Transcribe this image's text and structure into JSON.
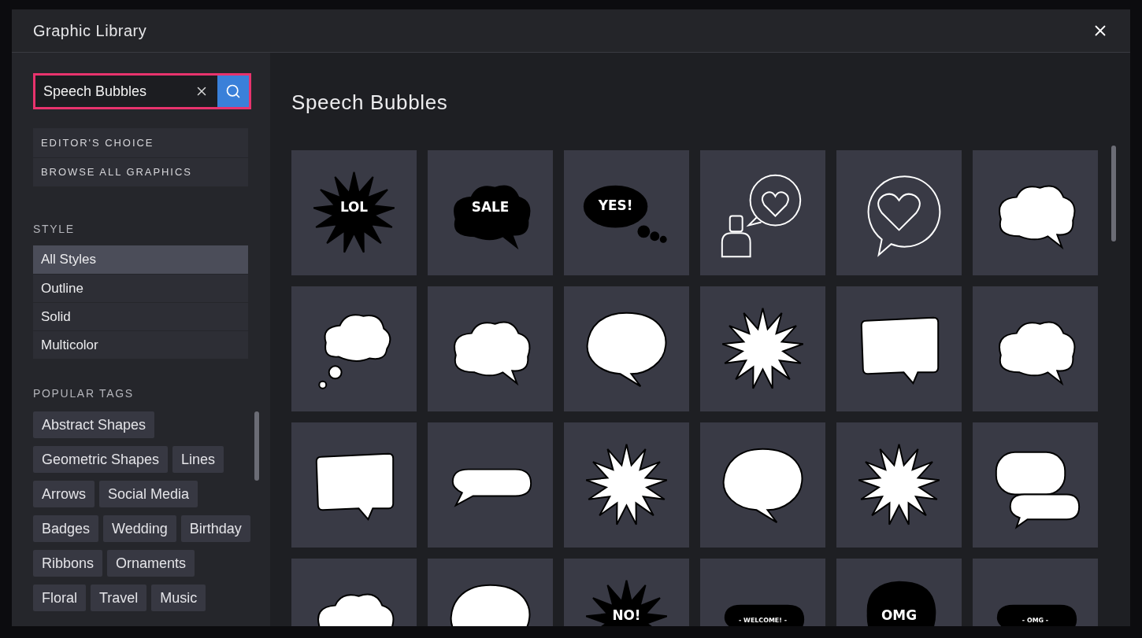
{
  "window": {
    "title": "Graphic Library"
  },
  "search": {
    "value": "Speech Bubbles"
  },
  "quick_links": [
    {
      "label": "EDITOR'S CHOICE"
    },
    {
      "label": "BROWSE ALL GRAPHICS"
    }
  ],
  "style": {
    "heading": "STYLE",
    "items": [
      {
        "label": "All Styles",
        "selected": true
      },
      {
        "label": "Outline",
        "selected": false
      },
      {
        "label": "Solid",
        "selected": false
      },
      {
        "label": "Multicolor",
        "selected": false
      }
    ]
  },
  "popular_tags": {
    "heading": "POPULAR TAGS",
    "tags": [
      "Abstract Shapes",
      "Geometric Shapes",
      "Lines",
      "Arrows",
      "Social Media",
      "Badges",
      "Wedding",
      "Birthday",
      "Ribbons",
      "Ornaments",
      "Floral",
      "Travel",
      "Music"
    ]
  },
  "gallery": {
    "title": "Speech Bubbles",
    "graphics": [
      {
        "kind": "burst",
        "inverted": true,
        "caption": "LOL"
      },
      {
        "kind": "cloud",
        "inverted": true,
        "caption": "SALE"
      },
      {
        "kind": "thought-oval",
        "inverted": true,
        "caption": "YES!"
      },
      {
        "kind": "person-heart",
        "inverted": false
      },
      {
        "kind": "heart-bubble",
        "inverted": false
      },
      {
        "kind": "cloud",
        "inverted": false
      },
      {
        "kind": "thought-cloud",
        "inverted": false
      },
      {
        "kind": "cloud",
        "inverted": false
      },
      {
        "kind": "oval",
        "inverted": false
      },
      {
        "kind": "burst",
        "inverted": false
      },
      {
        "kind": "rect",
        "inverted": false
      },
      {
        "kind": "cloud",
        "inverted": false
      },
      {
        "kind": "rect",
        "inverted": false
      },
      {
        "kind": "pill",
        "inverted": false
      },
      {
        "kind": "burst",
        "inverted": false
      },
      {
        "kind": "oval",
        "inverted": false
      },
      {
        "kind": "burst",
        "inverted": false
      },
      {
        "kind": "double",
        "inverted": false
      },
      {
        "kind": "cloud",
        "inverted": false
      },
      {
        "kind": "oval",
        "inverted": false
      },
      {
        "kind": "burst",
        "inverted": true,
        "caption": "NO!"
      },
      {
        "kind": "pill",
        "inverted": true,
        "caption": "- WELCOME! -"
      },
      {
        "kind": "blob",
        "inverted": true,
        "caption": "OMG"
      },
      {
        "kind": "pill",
        "inverted": true,
        "caption": "- OMG -"
      }
    ]
  }
}
